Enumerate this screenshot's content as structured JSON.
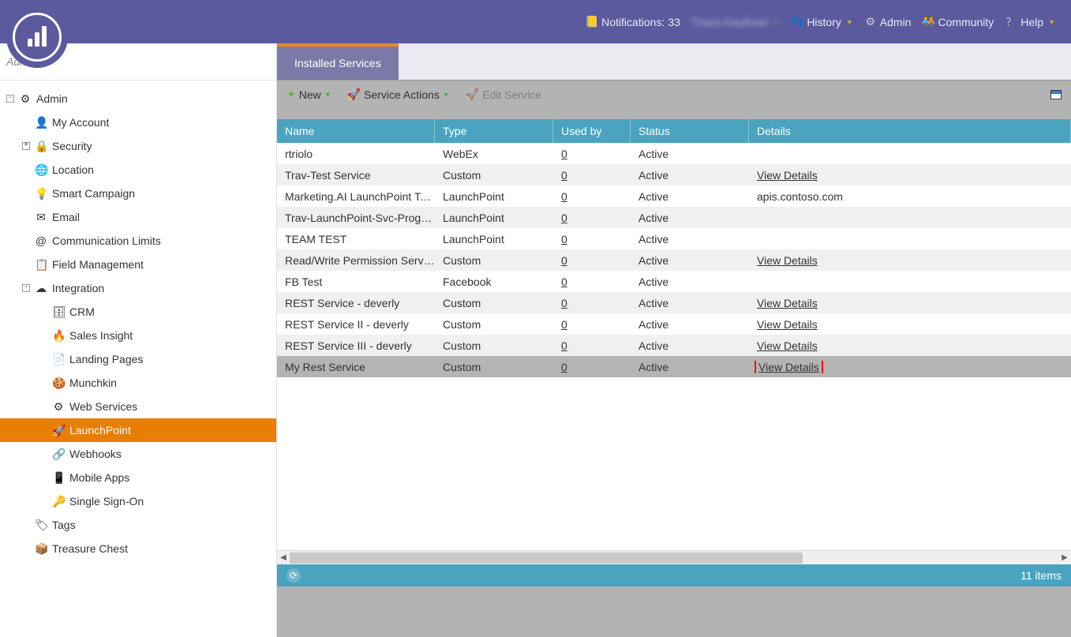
{
  "header": {
    "notifications_label": "Notifications:",
    "notifications_count": "33",
    "user_name": "Travis Kaufman",
    "history_label": "History",
    "admin_label": "Admin",
    "community_label": "Community",
    "help_label": "Help"
  },
  "breadcrumb": {
    "text": "Admin..."
  },
  "sidebar": {
    "nodes": [
      {
        "name": "admin-root",
        "icon": "⚙",
        "label": "Admin",
        "depth": 0,
        "expander": "-",
        "interact": true
      },
      {
        "name": "my-account",
        "icon": "👤",
        "label": "My Account",
        "depth": 1,
        "expander": "",
        "interact": true
      },
      {
        "name": "security",
        "icon": "🔒",
        "label": "Security",
        "depth": 1,
        "expander": "+",
        "interact": true
      },
      {
        "name": "location",
        "icon": "🌐",
        "label": "Location",
        "depth": 1,
        "expander": "",
        "interact": true
      },
      {
        "name": "smart-campaign",
        "icon": "💡",
        "label": "Smart Campaign",
        "depth": 1,
        "expander": "",
        "interact": true
      },
      {
        "name": "email",
        "icon": "✉",
        "label": "Email",
        "depth": 1,
        "expander": "",
        "interact": true
      },
      {
        "name": "communication-limits",
        "icon": "@",
        "label": "Communication Limits",
        "depth": 1,
        "expander": "",
        "interact": true
      },
      {
        "name": "field-management",
        "icon": "📋",
        "label": "Field Management",
        "depth": 1,
        "expander": "",
        "interact": true
      },
      {
        "name": "integration",
        "icon": "☁",
        "label": "Integration",
        "depth": 1,
        "expander": "-",
        "interact": true
      },
      {
        "name": "crm",
        "icon": "🗄",
        "label": "CRM",
        "depth": 2,
        "expander": "",
        "interact": true
      },
      {
        "name": "sales-insight",
        "icon": "🔥",
        "label": "Sales Insight",
        "depth": 2,
        "expander": "",
        "interact": true
      },
      {
        "name": "landing-pages",
        "icon": "📄",
        "label": "Landing Pages",
        "depth": 2,
        "expander": "",
        "interact": true
      },
      {
        "name": "munchkin",
        "icon": "🍪",
        "label": "Munchkin",
        "depth": 2,
        "expander": "",
        "interact": true
      },
      {
        "name": "web-services",
        "icon": "⚙",
        "label": "Web Services",
        "depth": 2,
        "expander": "",
        "interact": true
      },
      {
        "name": "launchpoint",
        "icon": "🚀",
        "label": "LaunchPoint",
        "depth": 2,
        "expander": "",
        "interact": true,
        "selected": true
      },
      {
        "name": "webhooks",
        "icon": "🔗",
        "label": "Webhooks",
        "depth": 2,
        "expander": "",
        "interact": true
      },
      {
        "name": "mobile-apps",
        "icon": "📱",
        "label": "Mobile Apps",
        "depth": 2,
        "expander": "",
        "interact": true
      },
      {
        "name": "single-sign-on",
        "icon": "🔑",
        "label": "Single Sign-On",
        "depth": 2,
        "expander": "",
        "interact": true
      },
      {
        "name": "tags",
        "icon": "🏷",
        "label": "Tags",
        "depth": 1,
        "expander": "",
        "interact": true
      },
      {
        "name": "treasure-chest",
        "icon": "📦",
        "label": "Treasure Chest",
        "depth": 1,
        "expander": "",
        "interact": true
      }
    ]
  },
  "tab": {
    "title": "Installed Services"
  },
  "toolbar": {
    "new_label": "New",
    "service_actions_label": "Service Actions",
    "edit_service_label": "Edit Service"
  },
  "table": {
    "columns": {
      "name": "Name",
      "type": "Type",
      "used_by": "Used by",
      "status": "Status",
      "details": "Details"
    },
    "rows": [
      {
        "name": "rtriolo",
        "type": "WebEx",
        "used_by": "0",
        "status": "Active",
        "details": ""
      },
      {
        "name": "Trav-Test Service",
        "type": "Custom",
        "used_by": "0",
        "status": "Active",
        "details": "View Details"
      },
      {
        "name": "Marketing.AI LaunchPoint Te...",
        "type": "LaunchPoint",
        "used_by": "0",
        "status": "Active",
        "details": "apis.contoso.com"
      },
      {
        "name": "Trav-LaunchPoint-Svc-Prog-I...",
        "type": "LaunchPoint",
        "used_by": "0",
        "status": "Active",
        "details": ""
      },
      {
        "name": "TEAM TEST",
        "type": "LaunchPoint",
        "used_by": "0",
        "status": "Active",
        "details": ""
      },
      {
        "name": "Read/Write Permission Servi...",
        "type": "Custom",
        "used_by": "0",
        "status": "Active",
        "details": "View Details"
      },
      {
        "name": "FB Test",
        "type": "Facebook",
        "used_by": "0",
        "status": "Active",
        "details": ""
      },
      {
        "name": "REST Service - deverly",
        "type": "Custom",
        "used_by": "0",
        "status": "Active",
        "details": "View Details"
      },
      {
        "name": "REST Service II - deverly",
        "type": "Custom",
        "used_by": "0",
        "status": "Active",
        "details": "View Details"
      },
      {
        "name": "REST Service III - deverly",
        "type": "Custom",
        "used_by": "0",
        "status": "Active",
        "details": "View Details"
      },
      {
        "name": "My Rest Service",
        "type": "Custom",
        "used_by": "0",
        "status": "Active",
        "details": "View Details",
        "selected": true,
        "highlight": true
      }
    ]
  },
  "footer": {
    "items_label": "11 items"
  }
}
